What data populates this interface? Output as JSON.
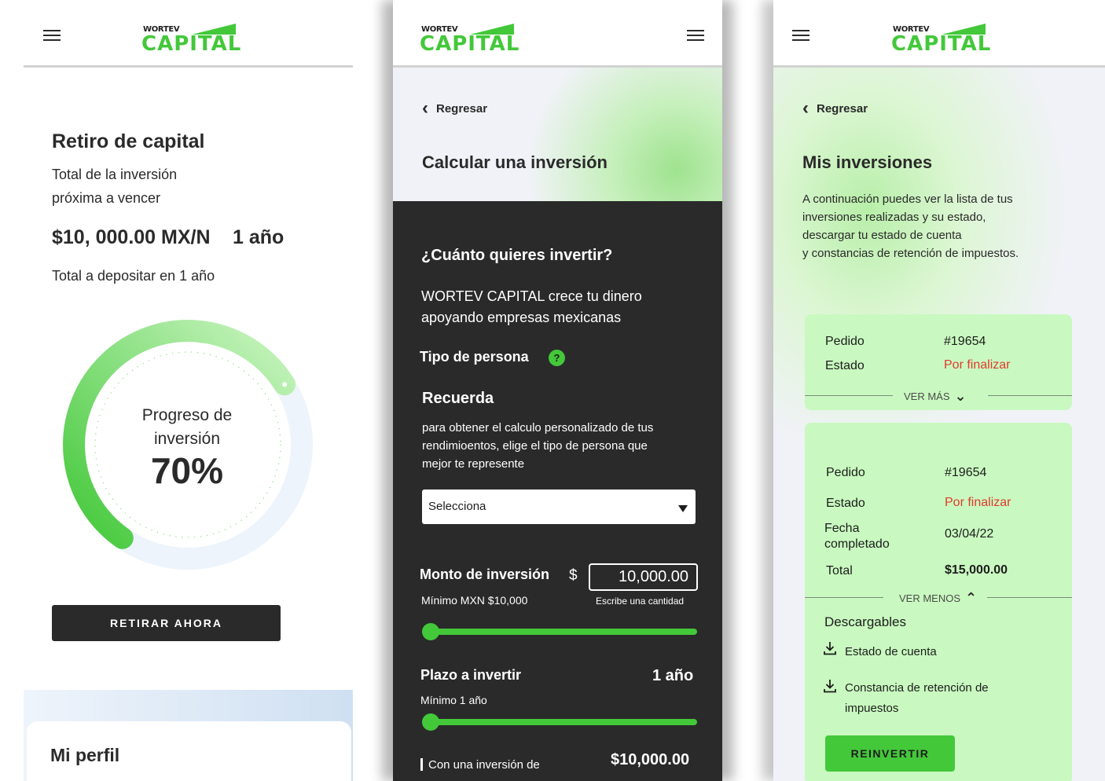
{
  "brand": {
    "line1": "WORTEV",
    "line2": "CAPITAL",
    "green": "#43c83a",
    "dark": "#2a2a2a"
  },
  "screen1": {
    "title": "Retiro de capital",
    "subtitle_line1": "Total de la inversión",
    "subtitle_line2": "próxima a vencer",
    "amount": "$10, 000.00 MX/N",
    "term": "1 año",
    "deposit_text": "Total a depositar en 1 año",
    "progress_label_line1": "Progreso de",
    "progress_label_line2": "inversión",
    "progress_pct_text": "70%",
    "progress_value": 0.7,
    "withdraw_button": "RETIRAR AHORA",
    "profile_title": "Mi perfil"
  },
  "screen2": {
    "back": "Regresar",
    "title": "Calcular una inversión",
    "question": "¿Cuánto quieres invertir?",
    "intro_line1": "WORTEV CAPITAL crece tu dinero",
    "intro_line2": "apoyando empresas mexicanas",
    "person_type_label": "Tipo de persona",
    "help_icon": "?",
    "remember_title": "Recuerda",
    "remember_line1": "para obtener el calculo personalizado de tus",
    "remember_line2": "rendimioentos, elige el tipo de persona que",
    "remember_line3": "mejor te represente",
    "select_value": "Selecciona",
    "amount_label": "Monto de inversión",
    "currency_symbol": "$",
    "amount_value": "10,000.00",
    "amount_min": "Mínimo MXN $10,000",
    "amount_hint": "Escribe una cantidad",
    "amount_slider_value": 0.0,
    "term_label": "Plazo a invertir",
    "term_value": "1 año",
    "term_min": "Mínimo 1 año",
    "term_slider_value": 0.0,
    "summary_label": "Con una inversión de",
    "summary_value": "$10,000.00"
  },
  "screen3": {
    "back": "Regresar",
    "title": "Mis inversiones",
    "desc_line1": "A continuación puedes ver la lista de tus",
    "desc_line2": "inversiones realizadas y su estado,",
    "desc_line3": "descargar tu estado de cuenta",
    "desc_line4": "y constancias de retención de impuestos.",
    "card1": {
      "order_label": "Pedido",
      "order_value": "#19654",
      "status_label": "Estado",
      "status_value": "Por finalizar",
      "toggle": "VER MÁS"
    },
    "card2": {
      "order_label": "Pedido",
      "order_value": "#19654",
      "status_label": "Estado",
      "status_value": "Por finalizar",
      "date_label_line1": "Fecha",
      "date_label_line2": "completado",
      "date_value": "03/04/22",
      "total_label": "Total",
      "total_value": "$15,000.00",
      "toggle": "VER MENOS",
      "downloads_title": "Descargables",
      "download1": "Estado de cuenta",
      "download2_line1": "Constancia de retención de",
      "download2_line2": "impuestos",
      "reinvest_button": "REINVERTIR"
    }
  }
}
